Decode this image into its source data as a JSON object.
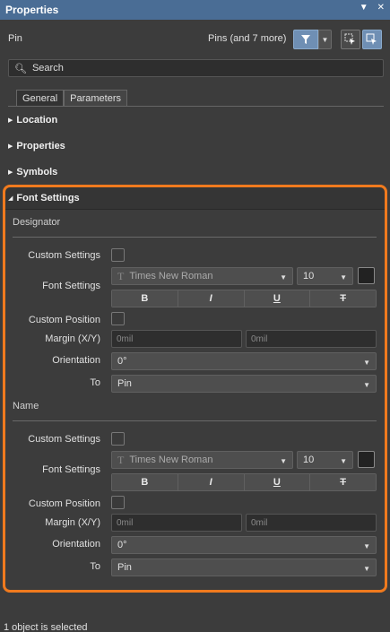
{
  "panel": {
    "title": "Properties",
    "menu_icon": "dropdown-triangle-icon",
    "close_icon": "close-icon"
  },
  "header": {
    "object_type": "Pin",
    "selection_info": "Pins (and 7 more)"
  },
  "search": {
    "placeholder": "Search",
    "icon": "search-icon"
  },
  "tabs": [
    {
      "label": "General"
    },
    {
      "label": "Parameters"
    }
  ],
  "sections": {
    "location": "Location",
    "properties": "Properties",
    "symbols": "Symbols",
    "font_settings": "Font Settings"
  },
  "designator": {
    "heading": "Designator",
    "custom_settings_label": "Custom Settings",
    "font_settings_label": "Font Settings",
    "font_family": "Times New Roman",
    "font_size": "10",
    "bold": "B",
    "italic": "I",
    "underline": "U",
    "strikeout": "T",
    "custom_position_label": "Custom Position",
    "margin_label": "Margin (X/Y)",
    "margin_x_placeholder": "0mil",
    "margin_y_placeholder": "0mil",
    "orientation_label": "Orientation",
    "orientation_value": "0°",
    "to_label": "To",
    "to_value": "Pin"
  },
  "name": {
    "heading": "Name",
    "custom_settings_label": "Custom Settings",
    "font_settings_label": "Font Settings",
    "font_family": "Times New Roman",
    "font_size": "10",
    "bold": "B",
    "italic": "I",
    "underline": "U",
    "strikeout": "T",
    "custom_position_label": "Custom Position",
    "margin_label": "Margin (X/Y)",
    "margin_x_placeholder": "0mil",
    "margin_y_placeholder": "0mil",
    "orientation_label": "Orientation",
    "orientation_value": "0°",
    "to_label": "To",
    "to_value": "Pin"
  },
  "status": "1 object is selected",
  "colors": {
    "title_bar": "#4a6d95",
    "highlight_border": "#f07a1e",
    "panel_bg": "#3c3c3c"
  }
}
